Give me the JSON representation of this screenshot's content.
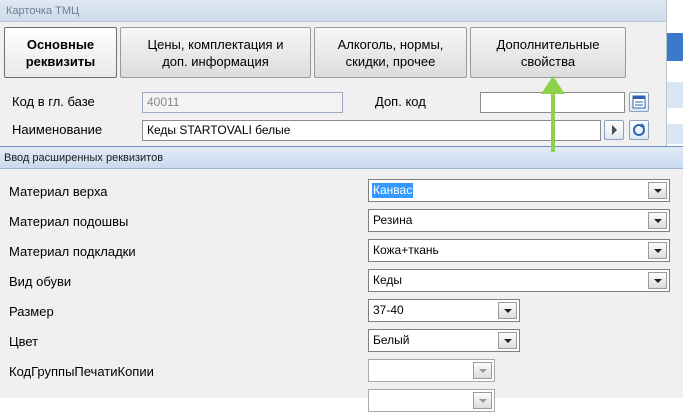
{
  "window": {
    "title": "Карточка ТМЦ"
  },
  "tabs": [
    {
      "label": "Основные\nреквизиты"
    },
    {
      "label": "Цены, комплектация и\nдоп.  информация"
    },
    {
      "label": "Алкоголь, нормы,\nскидки, прочее"
    },
    {
      "label": "Дополнительные\nсвойства"
    }
  ],
  "form": {
    "code_label": "Код в гл. базе",
    "code_value": "40011",
    "extra_code_label": "Доп. код",
    "extra_code_value": "",
    "name_label": "Наименование",
    "name_value": "Кеды STARTOVALI белые"
  },
  "dialog": {
    "title": "Ввод расширенных реквизитов",
    "rows": [
      {
        "label": "Материал верха",
        "value": "Канвас"
      },
      {
        "label": "Материал подошвы",
        "value": "Резина"
      },
      {
        "label": "Материал подкладки",
        "value": "Кожа+ткань"
      },
      {
        "label": "Вид обуви",
        "value": "Кеды"
      },
      {
        "label": "Размер",
        "value": "37-40"
      },
      {
        "label": "Цвет",
        "value": "Белый"
      },
      {
        "label": "КодГруппыПечатиКопии",
        "value": ""
      }
    ]
  },
  "annotation": {
    "arrow_color": "#8ed14a"
  }
}
